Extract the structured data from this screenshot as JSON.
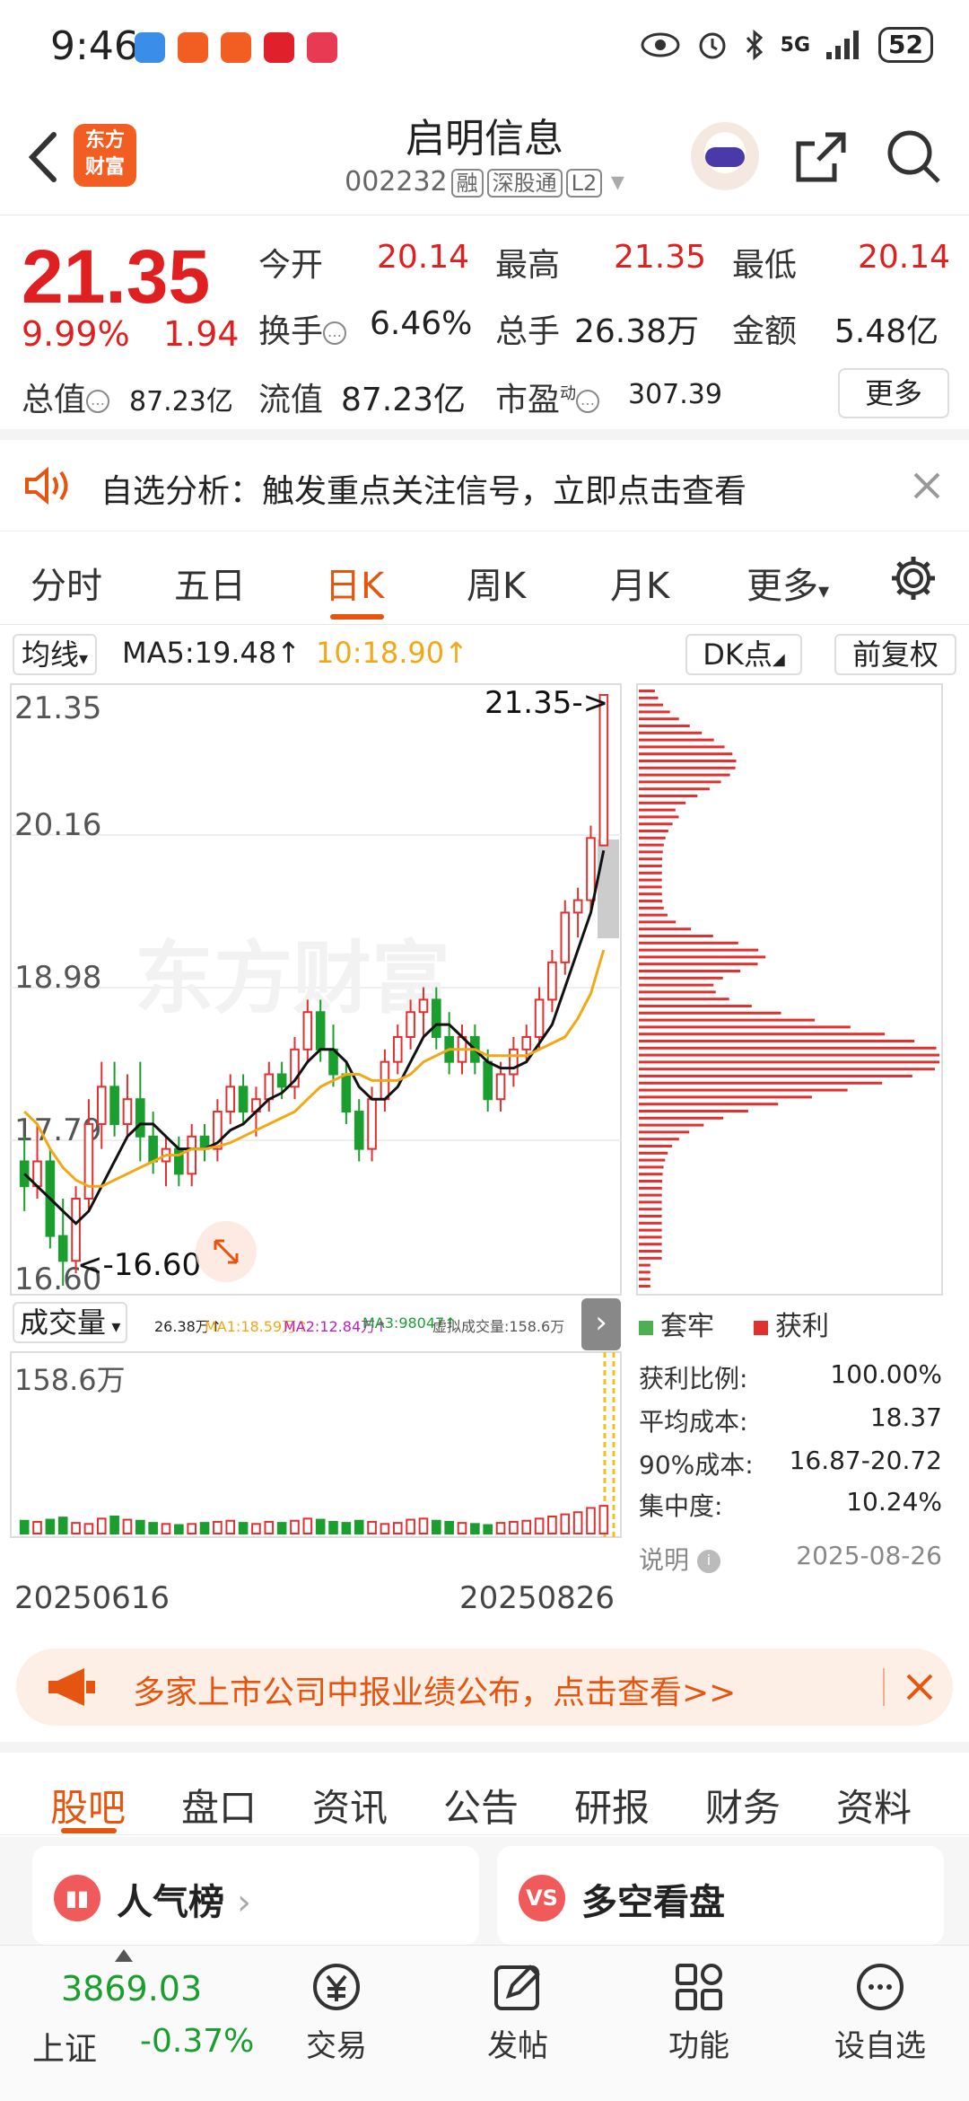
{
  "status_bar": {
    "time": "9:46",
    "network": "5G",
    "battery": "52"
  },
  "header": {
    "title": "启明信息",
    "code": "002232",
    "tags": [
      "融",
      "深股通",
      "L2"
    ],
    "logo_text": [
      "东方",
      "财富"
    ]
  },
  "quote": {
    "price": "21.35",
    "change_pct": "9.99%",
    "change": "1.94",
    "fields": {
      "open_label": "今开",
      "open": "20.14",
      "high_label": "最高",
      "high": "21.35",
      "low_label": "最低",
      "low": "20.14",
      "turnover_label": "换手",
      "turnover": "6.46%",
      "volume_label": "总手",
      "volume": "26.38万",
      "amount_label": "金额",
      "amount": "5.48亿",
      "mktcap_label": "总值",
      "mktcap": "87.23亿",
      "float_label": "流值",
      "float_cap": "87.23亿",
      "pe_label": "市盈",
      "pe_sup": "动",
      "pe": "307.39"
    },
    "more_button": "更多"
  },
  "banner": {
    "text": "自选分析：触发重点关注信号，立即点击查看"
  },
  "chart_tabs": {
    "items": [
      "分时",
      "五日",
      "日K",
      "周K",
      "月K",
      "更多"
    ],
    "active": "日K"
  },
  "chart_toolbar": {
    "ma_button": "均线",
    "ma5": "MA5:19.48↑",
    "ma10": "10:18.90↑",
    "dk_button": "DK点",
    "adjust_button": "前复权"
  },
  "chart_data": {
    "type": "candlestick",
    "y_axis_ticks": [
      "21.35",
      "20.16",
      "18.98",
      "17.79",
      "16.60"
    ],
    "ylim": [
      16.6,
      21.35
    ],
    "watermark": "东方财富",
    "annotations": {
      "high": "21.35->",
      "low": "<-16.60"
    },
    "x_labels": [
      "20250616",
      "20250826"
    ],
    "candles": [
      [
        17.6,
        17.8,
        17.2,
        17.4
      ],
      [
        17.4,
        17.9,
        17.3,
        17.6
      ],
      [
        17.6,
        17.7,
        16.9,
        17.0
      ],
      [
        17.0,
        17.3,
        16.6,
        16.8
      ],
      [
        16.8,
        17.4,
        16.7,
        17.3
      ],
      [
        17.3,
        18.1,
        17.2,
        17.9
      ],
      [
        17.9,
        18.4,
        17.7,
        18.2
      ],
      [
        18.2,
        18.4,
        17.8,
        17.9
      ],
      [
        17.9,
        18.3,
        17.8,
        18.1
      ],
      [
        18.1,
        18.4,
        17.6,
        17.8
      ],
      [
        17.8,
        18.0,
        17.5,
        17.6
      ],
      [
        17.6,
        17.8,
        17.4,
        17.7
      ],
      [
        17.7,
        17.8,
        17.4,
        17.5
      ],
      [
        17.5,
        17.9,
        17.4,
        17.8
      ],
      [
        17.8,
        17.9,
        17.6,
        17.7
      ],
      [
        17.7,
        18.1,
        17.6,
        18.0
      ],
      [
        18.0,
        18.3,
        17.9,
        18.2
      ],
      [
        18.2,
        18.3,
        17.9,
        18.0
      ],
      [
        18.0,
        18.2,
        17.8,
        18.1
      ],
      [
        18.1,
        18.4,
        18.0,
        18.3
      ],
      [
        18.3,
        18.4,
        18.1,
        18.2
      ],
      [
        18.2,
        18.6,
        18.1,
        18.5
      ],
      [
        18.5,
        18.9,
        18.4,
        18.8
      ],
      [
        18.8,
        18.9,
        18.4,
        18.5
      ],
      [
        18.5,
        18.7,
        18.2,
        18.3
      ],
      [
        18.3,
        18.4,
        17.9,
        18.0
      ],
      [
        18.0,
        18.1,
        17.6,
        17.7
      ],
      [
        17.7,
        18.2,
        17.6,
        18.1
      ],
      [
        18.1,
        18.5,
        18.0,
        18.4
      ],
      [
        18.4,
        18.7,
        18.3,
        18.6
      ],
      [
        18.6,
        18.9,
        18.5,
        18.8
      ],
      [
        18.8,
        19.0,
        18.6,
        18.9
      ],
      [
        18.9,
        19.0,
        18.5,
        18.6
      ],
      [
        18.6,
        18.8,
        18.3,
        18.4
      ],
      [
        18.4,
        18.7,
        18.3,
        18.6
      ],
      [
        18.6,
        18.7,
        18.3,
        18.4
      ],
      [
        18.4,
        18.5,
        18.0,
        18.1
      ],
      [
        18.1,
        18.4,
        18.0,
        18.3
      ],
      [
        18.3,
        18.6,
        18.2,
        18.5
      ],
      [
        18.5,
        18.7,
        18.4,
        18.6
      ],
      [
        18.6,
        19.0,
        18.5,
        18.9
      ],
      [
        18.9,
        19.3,
        18.8,
        19.2
      ],
      [
        19.2,
        19.7,
        19.1,
        19.6
      ],
      [
        19.6,
        19.8,
        19.4,
        19.7
      ],
      [
        19.7,
        20.3,
        19.6,
        20.2
      ],
      [
        20.14,
        21.35,
        20.14,
        21.35
      ]
    ],
    "ma5": [
      17.5,
      17.4,
      17.3,
      17.2,
      17.1,
      17.2,
      17.4,
      17.6,
      17.8,
      17.9,
      17.9,
      17.8,
      17.7,
      17.7,
      17.7,
      17.75,
      17.85,
      17.9,
      18.0,
      18.1,
      18.15,
      18.25,
      18.4,
      18.5,
      18.5,
      18.4,
      18.2,
      18.1,
      18.1,
      18.2,
      18.4,
      18.6,
      18.7,
      18.7,
      18.6,
      18.5,
      18.4,
      18.35,
      18.35,
      18.4,
      18.55,
      18.7,
      19.0,
      19.3,
      19.6,
      20.1
    ],
    "ma10": [
      18.0,
      17.9,
      17.7,
      17.55,
      17.45,
      17.4,
      17.4,
      17.45,
      17.5,
      17.55,
      17.6,
      17.65,
      17.65,
      17.7,
      17.7,
      17.72,
      17.75,
      17.8,
      17.85,
      17.9,
      17.95,
      18.0,
      18.1,
      18.2,
      18.25,
      18.3,
      18.3,
      18.25,
      18.25,
      18.25,
      18.3,
      18.4,
      18.45,
      18.5,
      18.5,
      18.5,
      18.45,
      18.45,
      18.45,
      18.45,
      18.5,
      18.55,
      18.6,
      18.75,
      18.95,
      19.3
    ],
    "volume": {
      "button": "成交量",
      "vol": "26.38万↑",
      "ma1": "MA1:18.59万↑",
      "ma2": "MA2:12.84万↑",
      "ma3": "MA3:98047↑",
      "virtual": "虚拟成交量:158.6万",
      "max_label": "158.6万",
      "values": [
        12,
        11,
        13,
        15,
        10,
        9,
        14,
        16,
        13,
        12,
        10,
        9,
        8,
        9,
        10,
        11,
        12,
        10,
        9,
        11,
        10,
        12,
        14,
        13,
        11,
        10,
        12,
        11,
        9,
        10,
        13,
        14,
        12,
        11,
        10,
        9,
        8,
        10,
        11,
        12,
        14,
        16,
        18,
        20,
        24,
        26
      ]
    },
    "chip_distribution": {
      "legend": [
        "套牢",
        "获利"
      ],
      "profit_ratio_label": "获利比例:",
      "profit_ratio": "100.00%",
      "avg_cost_label": "平均成本:",
      "avg_cost": "18.37",
      "cost90_label": "90%成本:",
      "cost90": "16.87-20.72",
      "concentration_label": "集中度:",
      "concentration": "10.24%",
      "note_label": "说明",
      "date": "2025-08-26"
    }
  },
  "notice": {
    "text": "多家上市公司中报业绩公布，点击查看>>"
  },
  "bottom_tabs": {
    "items": [
      "股吧",
      "盘口",
      "资讯",
      "公告",
      "研报",
      "财务",
      "资料"
    ],
    "active": "股吧"
  },
  "cards": [
    {
      "title": "人气榜",
      "icon": "bar-chart-icon"
    },
    {
      "title": "多空看盘",
      "icon": "vs-icon",
      "icon_text": "VS"
    }
  ],
  "footer": {
    "index_value": "3869.03",
    "index_name": "上证",
    "index_change": "-0.37%",
    "items": [
      "交易",
      "发帖",
      "功能",
      "设自选"
    ]
  }
}
